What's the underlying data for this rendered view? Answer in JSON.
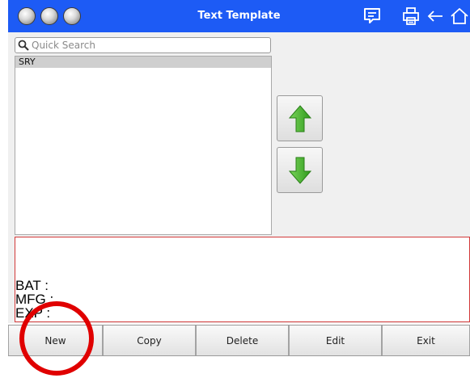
{
  "window": {
    "title": "Text Template"
  },
  "toolbar": {
    "icons": [
      "message-icon",
      "printer-icon",
      "back-arrow-icon",
      "home-icon"
    ]
  },
  "search": {
    "placeholder": "Quick Search",
    "value": ""
  },
  "templates": {
    "items": [
      "SRY"
    ],
    "selected": "SRY"
  },
  "preview": {
    "lines": [
      "BAT :",
      "MFG :",
      "EXP :"
    ]
  },
  "buttons": {
    "new": "New",
    "copy": "Copy",
    "delete": "Delete",
    "edit": "Edit",
    "exit": "Exit"
  },
  "colors": {
    "titlebar": "#1d5bf5",
    "arrow_green": "#3fae2a",
    "annotation_red": "#e00000"
  }
}
